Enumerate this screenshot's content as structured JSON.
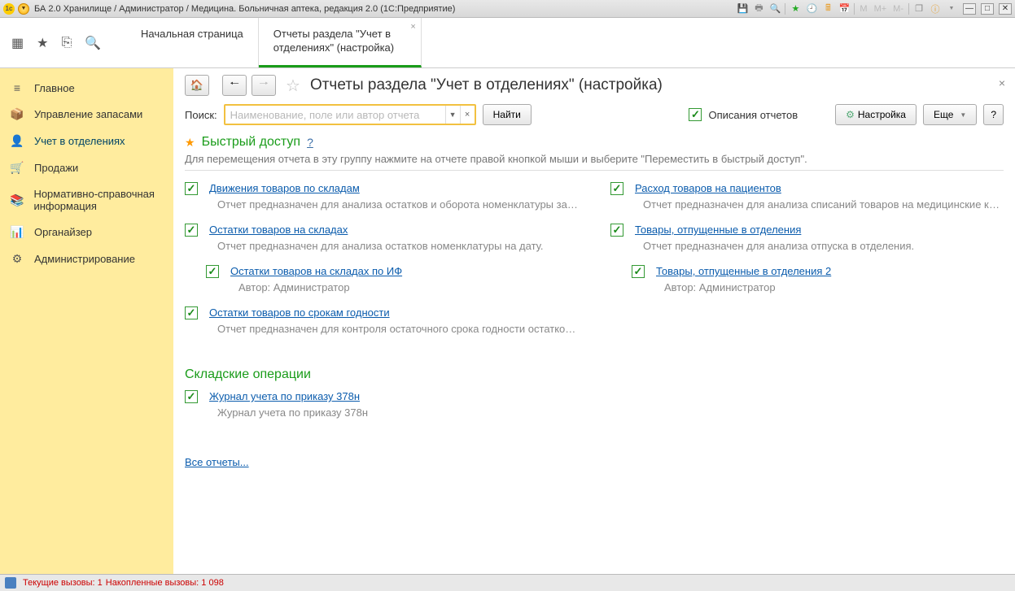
{
  "titlebar": {
    "text": "БА 2.0 Хранилище / Администратор / Медицина. Больничная аптека, редакция 2.0  (1С:Предприятие)"
  },
  "tabs": [
    {
      "label": "Начальная страница"
    },
    {
      "label": "Отчеты раздела \"Учет в отделениях\" (настройка)"
    }
  ],
  "sidebar": {
    "items": [
      {
        "icon": "≡",
        "label": "Главное"
      },
      {
        "icon": "📦",
        "label": "Управление запасами"
      },
      {
        "icon": "👤",
        "label": "Учет в отделениях"
      },
      {
        "icon": "🛒",
        "label": "Продажи"
      },
      {
        "icon": "📚",
        "label": "Нормативно-справочная информация"
      },
      {
        "icon": "📊",
        "label": "Органайзер"
      },
      {
        "icon": "⚙",
        "label": "Администрирование"
      }
    ]
  },
  "page": {
    "title": "Отчеты раздела \"Учет в отделениях\" (настройка)",
    "search_label": "Поиск:",
    "search_placeholder": "Наименование, поле или автор отчета",
    "find_btn": "Найти",
    "descriptions_chk": "Описания отчетов",
    "settings_btn": "Настройка",
    "more_btn": "Еще",
    "help_btn": "?"
  },
  "quick": {
    "title": "Быстрый доступ",
    "q": "?",
    "hint": "Для перемещения отчета в эту группу нажмите на отчете правой кнопкой мыши и выберите \"Переместить в быстрый доступ\"."
  },
  "reports": {
    "left": [
      {
        "title": "Движения товаров по складам",
        "desc": "Отчет предназначен для анализа остатков и оборота номенклатуры за пер...",
        "sub": false
      },
      {
        "title": "Остатки товаров на складах",
        "desc": "Отчет предназначен для анализа остатков номенклатуры на дату.",
        "sub": false
      },
      {
        "title": "Остатки товаров на складах по ИФ",
        "desc": "Автор: Администратор",
        "sub": true
      },
      {
        "title": "Остатки товаров по срокам годности",
        "desc": "Отчет предназначен для контроля остаточного срока годности остатков но...",
        "sub": false
      }
    ],
    "right": [
      {
        "title": "Расход товаров на пациентов",
        "desc": "Отчет предназначен для анализа списаний товаров на медицинские кар...",
        "sub": false
      },
      {
        "title": "Товары, отпущенные в отделения",
        "desc": "Отчет предназначен для анализа отпуска в отделения.",
        "sub": false
      },
      {
        "title": "Товары, отпущенные в отделения 2",
        "desc": "Автор: Администратор",
        "sub": true
      }
    ]
  },
  "section2": {
    "title": "Складские операции",
    "items": [
      {
        "title": "Журнал учета по приказу 378н",
        "desc": "Журнал учета по приказу 378н"
      }
    ]
  },
  "all_reports": "Все отчеты...",
  "status": {
    "current": "Текущие вызовы: 1",
    "accum": "Накопленные вызовы: 1 098"
  }
}
